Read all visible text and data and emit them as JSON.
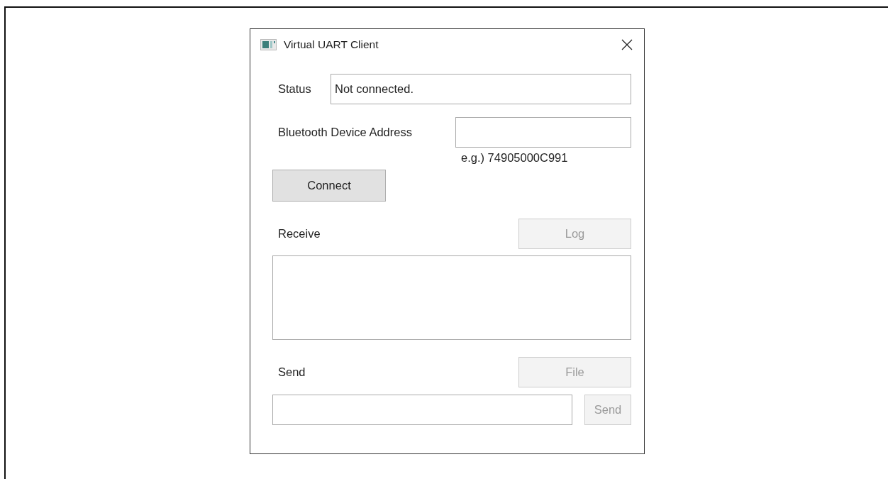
{
  "window": {
    "title": "Virtual UART Client"
  },
  "status": {
    "label": "Status",
    "value": "Not connected."
  },
  "address": {
    "label": "Bluetooth Device Address",
    "hint": "e.g.) 74905000C991"
  },
  "connect_button": {
    "label": "Connect",
    "disabled": false
  },
  "receive": {
    "label": "Receive",
    "log_button": {
      "label": "Log",
      "disabled": true
    }
  },
  "send": {
    "label": "Send",
    "file_button": {
      "label": "File",
      "disabled": true
    },
    "send_button": {
      "label": "Send",
      "disabled": true
    }
  }
}
